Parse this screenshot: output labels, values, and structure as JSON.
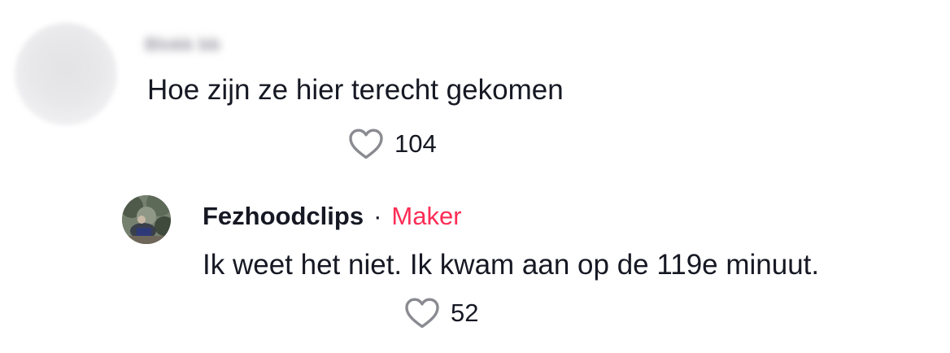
{
  "comments": [
    {
      "username": "Blokk bb",
      "text": "Hoe zijn ze hier terecht gekomen",
      "likes": "104"
    }
  ],
  "reply": {
    "username": "Fezhoodclips",
    "separator": "·",
    "badge": "Maker",
    "text": "Ik weet het niet. Ik kwam aan op de 119e minuut.",
    "likes": "52"
  },
  "colors": {
    "text": "#161823",
    "maker_badge": "#fe2c55",
    "icon": "#8a8b91"
  },
  "icons": {
    "like": "heart-outline-icon"
  }
}
